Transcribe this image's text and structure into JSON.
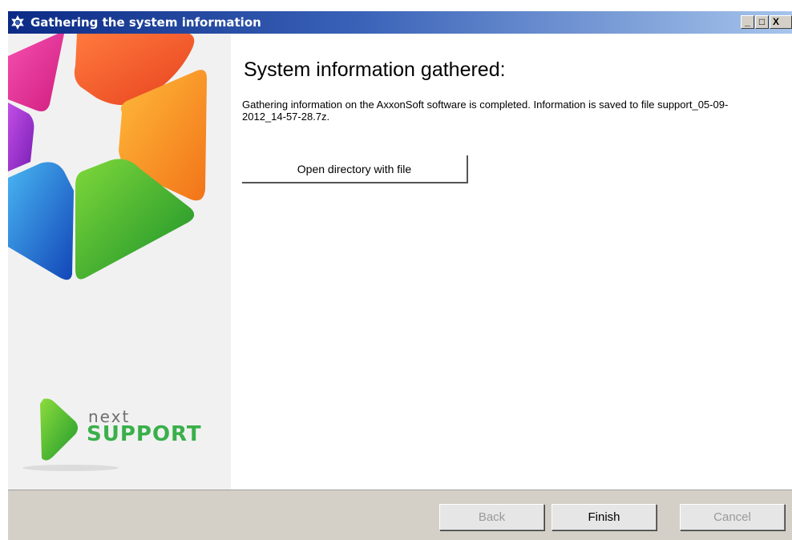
{
  "window": {
    "title": "Gathering the system information",
    "minimize": "_",
    "maximize": "□",
    "close": "X"
  },
  "branding": {
    "logo_line1": "next",
    "logo_line2": "SUPPORT"
  },
  "main": {
    "heading": "System information gathered:",
    "description": "Gathering information on the AxxonSoft software is completed. Information is saved to file support_05-09-2012_14-57-28.7z.",
    "open_button": "Open directory with file"
  },
  "footer": {
    "back": "Back",
    "finish": "Finish",
    "cancel": "Cancel"
  },
  "colors": {
    "titlebar_start": "#0b2a85",
    "titlebar_end": "#a6c4ec",
    "brand_green": "#39b04a"
  }
}
